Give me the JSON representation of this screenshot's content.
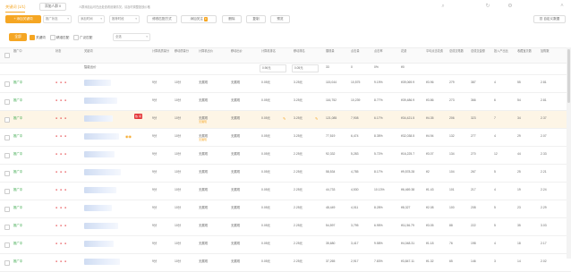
{
  "tabs": [
    {
      "label": "关键词 (1/1)",
      "active": true
    },
    {
      "label": "添加人群 0",
      "active": false
    }
  ],
  "tip": "人群添加后可在此处查看设置情况，请及时调整投放价格",
  "toolbar": {
    "add_button": "+ 添加关键词",
    "select1": "推广状态",
    "select2": "添加时间",
    "select3": "推荐时段",
    "btn_match": "修改匹配方式",
    "btn_add_filter": "添加关注",
    "btn_add_filter_badge": "0",
    "btn_delete": "删除",
    "btn_copy": "复制",
    "btn_preview": "预览",
    "custom_columns": "自定义数据"
  },
  "filter": {
    "btn_orange": "全部",
    "chk1": "关键词",
    "chk2": "精准匹配",
    "chk3": "广泛匹配",
    "select": "全选"
  },
  "columns": [
    "推广中",
    "状态",
    "关键词",
    "计算机质量分",
    "移动质量分",
    "计算机出价",
    "移动出价",
    "计算机排名",
    "移动排名",
    "展现量",
    "点击量",
    "点击率",
    "花费",
    "平均点击花费",
    "总成交笔数",
    "总成交金额",
    "投入产出比",
    "收藏宝贝数",
    "加购数"
  ],
  "header_inputs": {
    "pc_price": "0.96元",
    "mobile_price": "0.05元",
    "impr": "33",
    "clicks": "0",
    "ctr": "0%",
    "cost": "¥0"
  },
  "header_label": "智能出价",
  "rows": [
    {
      "status": "推广中",
      "q1": "9分",
      "q2": "10分",
      "rank1": "无展现",
      "rank2": "无展现",
      "pc": "0.05元",
      "mb": "3.25元",
      "impr": "115,044",
      "clicks": "10,575",
      "ctr": "9.19%",
      "cost": "¥39,069.9",
      "cpc": "¥3.96",
      "o1": "279",
      "o2": "387",
      "o3": "4",
      "o4": "55",
      "o5": "2.81",
      "sub": ""
    },
    {
      "status": "推广中",
      "q1": "9分",
      "q2": "10分",
      "rank1": "无展现",
      "rank2": "无展现",
      "pc": "0.05元",
      "mb": "3.25元",
      "impr": "116,752",
      "clicks": "10,239",
      "ctr": "8.77%",
      "cost": "¥39,486.9",
      "cpc": "¥3.86",
      "o1": "273",
      "o2": "366",
      "o3": "6",
      "o4": "54",
      "o5": "2.81",
      "sub": ""
    },
    {
      "status": "推广中",
      "q1": "9分",
      "q2": "10分",
      "rank1": "无展现",
      "rank2": "无展现",
      "pc": "0.05元",
      "mb": "3.25元",
      "impr": "121,085",
      "clicks": "7,908",
      "ctr": "6.17%",
      "cost": "¥34,421.5",
      "cpc": "¥4.35",
      "o1": "206",
      "o2": "323",
      "o3": "7",
      "o4": "34",
      "o5": "2.37",
      "sub": "无展现"
    },
    {
      "status": "推广中",
      "q1": "9分",
      "q2": "10分",
      "rank1": "无展现",
      "rank2": "无展现",
      "pc": "0.05元",
      "mb": "3.25元",
      "impr": "77,519",
      "clicks": "6,474",
      "ctr": "8.35%",
      "cost": "¥32,038.5",
      "cpc": "¥4.94",
      "o1": "132",
      "o2": "277",
      "o3": "4",
      "o4": "29",
      "o5": "2.07",
      "sub": "无展现"
    },
    {
      "status": "推广中",
      "q1": "9分",
      "q2": "10分",
      "rank1": "无展现",
      "rank2": "无展现",
      "pc": "0.05元",
      "mb": "2.25元",
      "impr": "92,332",
      "clicks": "5,283",
      "ctr": "5.72%",
      "cost": "¥16,225.7",
      "cpc": "¥3.07",
      "o1": "134",
      "o2": "270",
      "o3": "12",
      "o4": "44",
      "o5": "2.33",
      "sub": ""
    },
    {
      "status": "推广中",
      "q1": "9分",
      "q2": "10分",
      "rank1": "无展现",
      "rank2": "无展现",
      "pc": "0.05元",
      "mb": "2.25元",
      "impr": "58,534",
      "clicks": "4,785",
      "ctr": "8.17%",
      "cost": "¥9,578.28",
      "cpc": "¥2",
      "o1": "104",
      "o2": "267",
      "o3": "5",
      "o4": "25",
      "o5": "2.21",
      "sub": ""
    },
    {
      "status": "推广中",
      "q1": "9分",
      "q2": "10分",
      "rank1": "无展现",
      "rank2": "无展现",
      "pc": "0.05元",
      "mb": "2.25元",
      "impr": "44,733",
      "clicks": "4,530",
      "ctr": "10.13%",
      "cost": "¥6,469.38",
      "cpc": "¥1.43",
      "o1": "101",
      "o2": "217",
      "o3": "4",
      "o4": "19",
      "o5": "2.24",
      "sub": ""
    },
    {
      "status": "推广中",
      "q1": "9分",
      "q2": "10分",
      "rank1": "无展现",
      "rank2": "无展现",
      "pc": "0.05元",
      "mb": "2.25元",
      "impr": "48,449",
      "clicks": "4,011",
      "ctr": "8.28%",
      "cost": "¥8,327",
      "cpc": "¥2.08",
      "o1": "100",
      "o2": "208",
      "o3": "5",
      "o4": "23",
      "o5": "2.29",
      "sub": ""
    },
    {
      "status": "推广中",
      "q1": "9分",
      "q2": "10分",
      "rank1": "无展现",
      "rank2": "无展现",
      "pc": "0.05元",
      "mb": "2.25元",
      "impr": "54,597",
      "clicks": "3,795",
      "ctr": "6.95%",
      "cost": "¥11,56.79",
      "cpc": "¥3.05",
      "o1": "88",
      "o2": "222",
      "o3": "5",
      "o4": "35",
      "o5": "3.03",
      "sub": ""
    },
    {
      "status": "推广中",
      "q1": "9分",
      "q2": "10分",
      "rank1": "无展现",
      "rank2": "无展现",
      "pc": "0.05元",
      "mb": "2.25元",
      "impr": "35,680",
      "clicks": "3,417",
      "ctr": "9.58%",
      "cost": "¥4,048.31",
      "cpc": "¥1.18",
      "o1": "76",
      "o2": "198",
      "o3": "4",
      "o4": "18",
      "o5": "2.17",
      "sub": ""
    },
    {
      "status": "推广中",
      "q1": "9分",
      "q2": "10分",
      "rank1": "无展现",
      "rank2": "无展现",
      "pc": "0.05元",
      "mb": "2.25元",
      "impr": "37,265",
      "clicks": "2,917",
      "ctr": "7.83%",
      "cost": "¥3,847.11",
      "cpc": "¥1.32",
      "o1": "65",
      "o2": "146",
      "o3": "3",
      "o4": "14",
      "o5": "2.02",
      "sub": ""
    }
  ],
  "colors": {
    "accent": "#f5a623",
    "green": "#3aa84b"
  }
}
